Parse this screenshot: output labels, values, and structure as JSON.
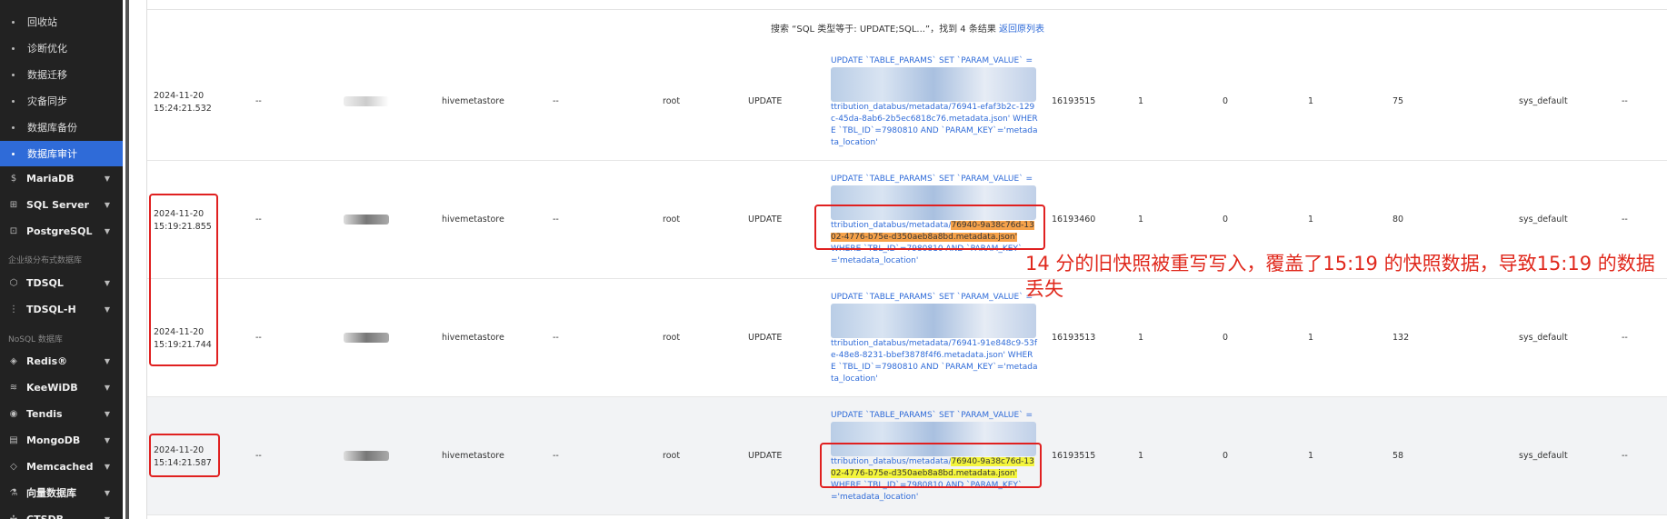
{
  "sidebar": {
    "sub_items": [
      "回收站",
      "诊断优化",
      "数据迁移",
      "灾备同步",
      "数据库备份",
      "数据库审计"
    ],
    "groups_a": [
      "MariaDB",
      "SQL Server",
      "PostgreSQL"
    ],
    "section_1": "企业级分布式数据库",
    "groups_b": [
      "TDSQL",
      "TDSQL-H"
    ],
    "section_2": "NoSQL 数据库",
    "groups_c": [
      "Redis®",
      "KeeWiDB",
      "Tendis",
      "MongoDB",
      "Memcached",
      "向量数据库",
      "CTSDB"
    ]
  },
  "notice": {
    "text": "搜索 “SQL 类型等于: UPDATE;SQL...”，找到 4 条结果",
    "link": "返回原列表"
  },
  "rows": [
    {
      "time": "2024-11-20\n15:24:21.532",
      "col2": "--",
      "db": "hivemetastore",
      "col5": "--",
      "user": "root",
      "type": "UPDATE",
      "sql_a": "UPDATE `TABLE_PARAMS` SET `PARAM_VALUE` =",
      "sql_b": "ttribution_databus/metadata/76941-efaf3b2c-129c-45da-8ab6-2b5ec6818c76.metadata.json' WHERE `TBL_ID`=7980810 AND `PARAM_KEY`='metadata_location'",
      "sql_mark": "",
      "thread": "16193515",
      "c1": "1",
      "c2": "0",
      "c3": "1",
      "ms": "75",
      "pool": "sys_default",
      "last": "--"
    },
    {
      "time": "2024-11-20\n15:19:21.855",
      "col2": "--",
      "db": "hivemetastore",
      "col5": "--",
      "user": "root",
      "type": "UPDATE",
      "sql_a": "UPDATE `TABLE_PARAMS` SET `PARAM_VALUE` =",
      "sql_b": "ttribution_databus/metadata/",
      "sql_mark": "76940-9a38c76d-1302-4776-b75e-d350aeb8a8bd.metadata.json'",
      "sql_c": "WHERE `TBL_ID`=7980810 AND `PARAM_KEY`='metadata_location'",
      "thread": "16193460",
      "c1": "1",
      "c2": "0",
      "c3": "1",
      "ms": "80",
      "pool": "sys_default",
      "last": "--"
    },
    {
      "time": "2024-11-20\n15:19:21.744",
      "col2": "--",
      "db": "hivemetastore",
      "col5": "--",
      "user": "root",
      "type": "UPDATE",
      "sql_a": "UPDATE `TABLE_PARAMS` SET `PARAM_VALUE` =",
      "sql_b": "ttribution_databus/metadata/76941-91e848c9-53fe-48e8-8231-bbef3878f4f6.metadata.json' WHERE `TBL_ID`=7980810 AND `PARAM_KEY`='metadata_location'",
      "sql_mark": "",
      "thread": "16193513",
      "c1": "1",
      "c2": "0",
      "c3": "1",
      "ms": "132",
      "pool": "sys_default",
      "last": "--"
    },
    {
      "time": "2024-11-20\n15:14:21.587",
      "col2": "--",
      "db": "hivemetastore",
      "col5": "--",
      "user": "root",
      "type": "UPDATE",
      "sql_a": "UPDATE `TABLE_PARAMS` SET `PARAM_VALUE` =",
      "sql_b": "ttribution_databus/metadata/",
      "sql_mark": "76940-9a38c76d-1302-4776-b75e-d350aeb8a8bd.metadata.json'",
      "sql_c": "WHERE `TBL_ID`=7980810 AND `PARAM_KEY`='metadata_location'",
      "thread": "16193515",
      "c1": "1",
      "c2": "0",
      "c3": "1",
      "ms": "58",
      "pool": "sys_default",
      "last": "--"
    }
  ],
  "annotation": "14 分的旧快照被重写写入，覆盖了15:19 的快照数据，导致15:19 的数据丢失",
  "colors": {
    "accent": "#2f6bd8",
    "highlight_orange": "#f6a24a",
    "highlight_yellow": "#f4f53c",
    "annotation_red": "#e0281c"
  }
}
